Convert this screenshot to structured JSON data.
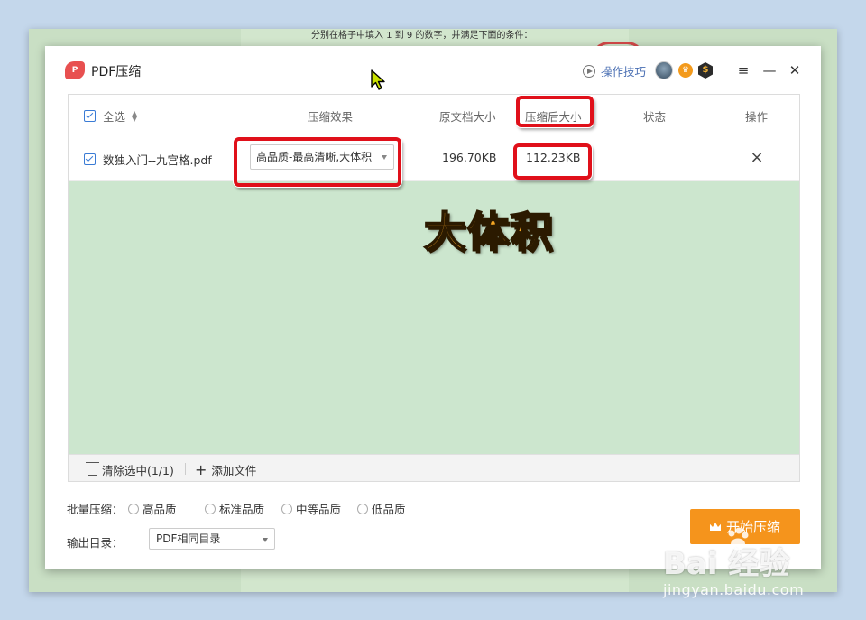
{
  "background": {
    "text": "分别在格子中填入 1 到 9 的数字，并满足下面的条件："
  },
  "app": {
    "title": "PDF压缩",
    "logo_text": "P",
    "tips_label": "操作技巧",
    "window_controls": [
      "menu",
      "minimize",
      "close"
    ]
  },
  "table": {
    "headers": {
      "select_all": "全选",
      "effect": "压缩效果",
      "original_size": "原文档大小",
      "compressed_size": "压缩后大小",
      "status": "状态",
      "action": "操作"
    },
    "rows": [
      {
        "checked": true,
        "filename": "数独入门--九宫格.pdf",
        "quality": "高品质-最高清晰,大体积",
        "original_size": "196.70KB",
        "compressed_size": "112.23KB",
        "status": ""
      }
    ],
    "footer": {
      "clear_selected": "清除选中(1/1)",
      "add_file": "添加文件"
    }
  },
  "annotation": "大体积",
  "batch": {
    "label": "批量压缩：",
    "options": [
      "高品质",
      "标准品质",
      "中等品质",
      "低品质"
    ]
  },
  "output": {
    "label": "输出目录：",
    "value": "PDF相同目录"
  },
  "start_button": "开始压缩",
  "watermark": {
    "logo": "Bai  经验",
    "url": "jingyan.baidu.com"
  },
  "colors": {
    "accent_blue": "#3a7bd5",
    "start_orange": "#f5941c",
    "highlight_red": "#e0101a",
    "annotation_orange": "#f5a623"
  }
}
